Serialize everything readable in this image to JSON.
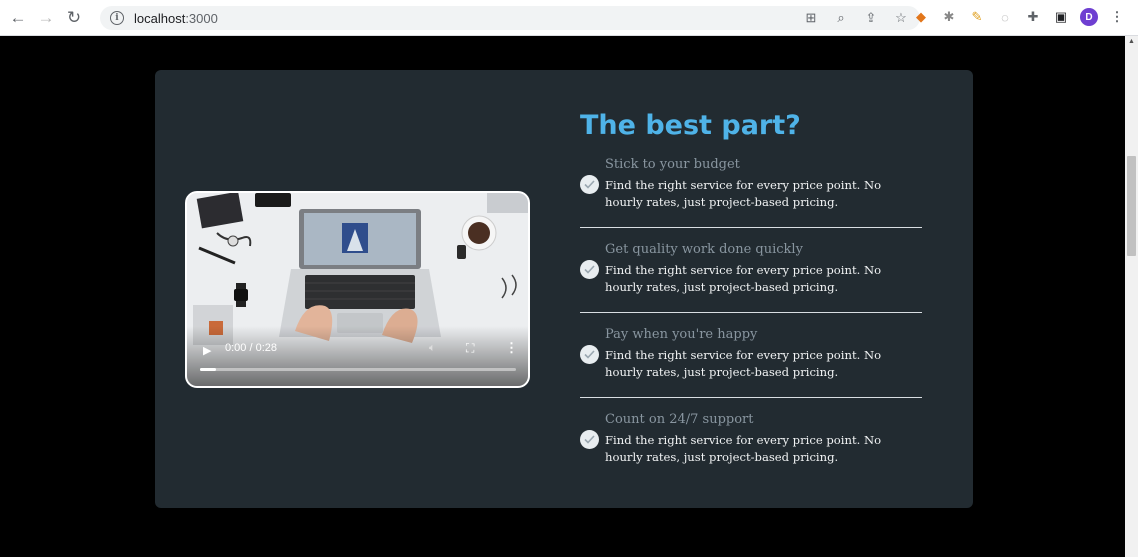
{
  "browser": {
    "url_host": "localhost",
    "url_port": ":3000",
    "profile_initial": "D"
  },
  "section": {
    "heading": "The best part?",
    "features": [
      {
        "title": "Stick to your budget",
        "description": "Find the right service for every price point. No hourly rates, just project-based pricing."
      },
      {
        "title": "Get quality work done quickly",
        "description": "Find the right service for every price point. No hourly rates, just project-based pricing."
      },
      {
        "title": "Pay when you're happy",
        "description": "Find the right service for every price point. No hourly rates, just project-based pricing."
      },
      {
        "title": "Count on 24/7 support",
        "description": "Find the right service for every price point. No hourly rates, just project-based pricing."
      }
    ]
  },
  "video": {
    "time_display": "0:00 / 0:28",
    "progress_fraction": 0.05
  },
  "colors": {
    "page_background": "#000000",
    "card_background": "#222b31",
    "heading": "#4fb3e8",
    "feature_title": "#8996a0",
    "feature_text": "#f2f4f5"
  }
}
